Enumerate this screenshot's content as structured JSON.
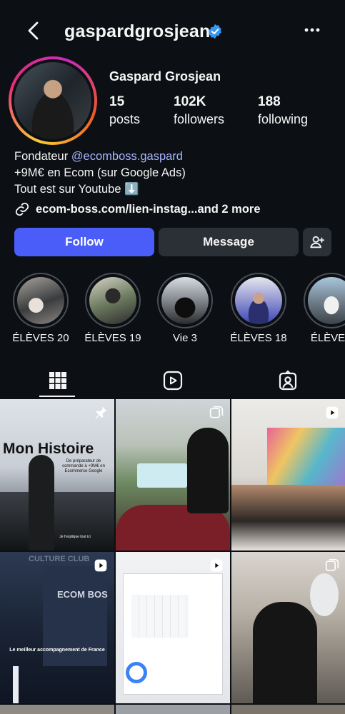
{
  "header": {
    "username": "gaspardgrosjean",
    "back_icon": "chevron-left-icon",
    "verified_icon": "verified-badge-icon",
    "more_icon": "more-horizontal-icon"
  },
  "profile": {
    "full_name": "Gaspard Grosjean",
    "stats": [
      {
        "value": "15",
        "label": "posts"
      },
      {
        "value": "102K",
        "label": "followers"
      },
      {
        "value": "188",
        "label": "following"
      }
    ],
    "bio": {
      "line1_prefix": "Fondateur ",
      "line1_mention": "@ecomboss.gaspard",
      "line2": "+9M€ en Ecom (sur Google Ads)",
      "line3": "Tout est sur Youtube ⬇️"
    },
    "link": {
      "url": "ecom-boss.com/lien-instag...",
      "more": " and 2 more",
      "icon": "link-icon"
    }
  },
  "actions": {
    "follow": "Follow",
    "message": "Message",
    "add_user_icon": "add-user-icon",
    "follow_color": "#4a5df9"
  },
  "highlights": [
    {
      "label": "ÉLÈVES 20"
    },
    {
      "label": "ÉLÈVES 19"
    },
    {
      "label": "Vie 3"
    },
    {
      "label": "ÉLÈVES 18"
    },
    {
      "label": "ÉLÈVES"
    }
  ],
  "tabs": [
    {
      "name": "posts",
      "icon": "grid-icon",
      "active": true
    },
    {
      "name": "reels",
      "icon": "reels-icon",
      "active": false
    },
    {
      "name": "tagged",
      "icon": "tagged-icon",
      "active": false
    }
  ],
  "posts": {
    "p1_title": "Mon Histoire",
    "p1_subtitle": "De préparateur de commande à +9M€ en Ecommerce Google",
    "p1_caption": "Je t'explique tout ici",
    "p4_watermark_top": "CULTURE CLUB",
    "p4_watermark": "ECOM BOS",
    "p4_caption": "Le meilleur accompagnement de France"
  },
  "colors": {
    "background": "#0c1014",
    "mention": "#a8b4ff",
    "secondary_button": "#2b3036"
  }
}
